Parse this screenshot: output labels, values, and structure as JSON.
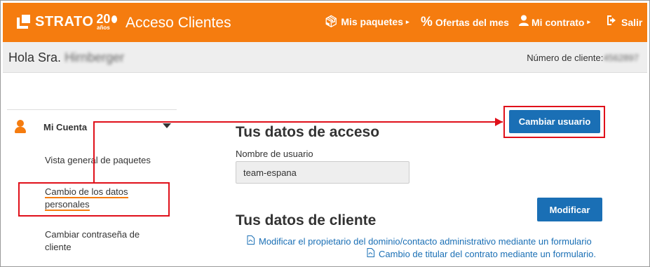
{
  "header": {
    "logo_text": "STRATO",
    "logo_years": "20",
    "logo_years_sub": "años",
    "app_title": "Acceso Clientes",
    "nav": {
      "paquetes": "Mis paquetes",
      "ofertas": "Ofertas del mes",
      "contrato": "Mi contrato",
      "salir": "Salir"
    },
    "brand_color": "#f57c0f"
  },
  "subbar": {
    "greeting": "Hola Sra.",
    "greeting_name_redacted": "Hirnberger",
    "client_label": "Número de cliente:",
    "client_no_redacted": "4562897"
  },
  "sidebar": {
    "account_label": "Mi Cuenta",
    "items": [
      {
        "label": "Vista general de paquetes"
      },
      {
        "label": "Cambio de los datos personales"
      },
      {
        "label": "Cambiar contraseña de cliente"
      }
    ]
  },
  "main": {
    "access_title": "Tus datos de acceso",
    "username_label": "Nombre de usuario",
    "username_value": "team-espana",
    "change_user_button": "Cambiar usuario",
    "client_title": "Tus datos de cliente",
    "modify_button": "Modificar",
    "links": [
      "Modificar el propietario del dominio/contacto administrativo mediante un formulario",
      "Cambio de titular del contrato mediante un formulario."
    ]
  },
  "colors": {
    "accent": "#f57c0f",
    "button": "#1a6fb5",
    "annotation": "#e0101a"
  }
}
